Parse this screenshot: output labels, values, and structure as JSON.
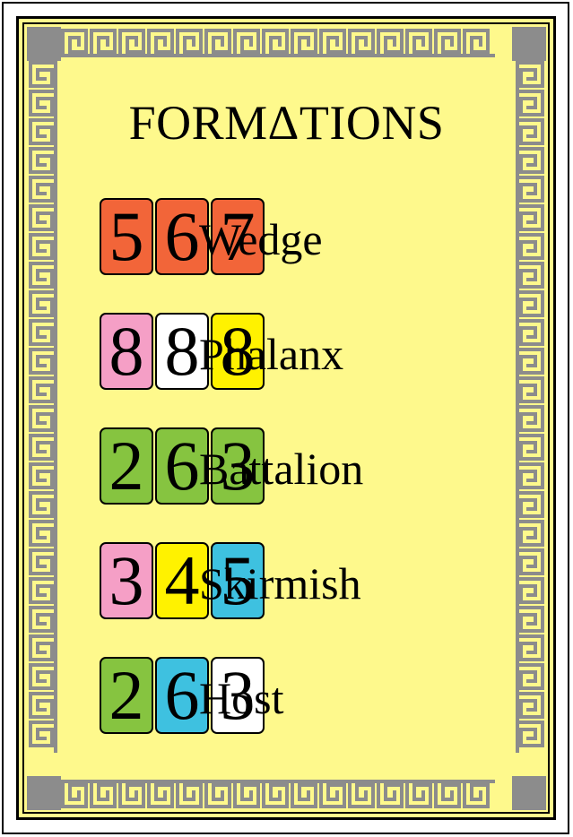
{
  "card": {
    "title": "FORMΔTIONS",
    "colors": {
      "background": "#fef98c",
      "border_pattern": "#8c8c8c",
      "corner": "#8c8c8c"
    },
    "formations": [
      {
        "name": "Wedge",
        "tiles": [
          {
            "value": "5",
            "color": "#f26539"
          },
          {
            "value": "6",
            "color": "#f26539"
          },
          {
            "value": "7",
            "color": "#f26539"
          }
        ]
      },
      {
        "name": "Phalanx",
        "tiles": [
          {
            "value": "8",
            "color": "#f59fc6"
          },
          {
            "value": "8",
            "color": "#ffffff"
          },
          {
            "value": "8",
            "color": "#fff200"
          }
        ]
      },
      {
        "name": "Battalion",
        "tiles": [
          {
            "value": "2",
            "color": "#86c440"
          },
          {
            "value": "6",
            "color": "#86c440"
          },
          {
            "value": "3",
            "color": "#86c440"
          }
        ]
      },
      {
        "name": "Skirmish",
        "tiles": [
          {
            "value": "3",
            "color": "#f59fc6"
          },
          {
            "value": "4",
            "color": "#fff200"
          },
          {
            "value": "5",
            "color": "#3ec1e0"
          }
        ]
      },
      {
        "name": "Host",
        "tiles": [
          {
            "value": "2",
            "color": "#86c440"
          },
          {
            "value": "6",
            "color": "#3ec1e0"
          },
          {
            "value": "3",
            "color": "#ffffff"
          }
        ]
      }
    ]
  }
}
